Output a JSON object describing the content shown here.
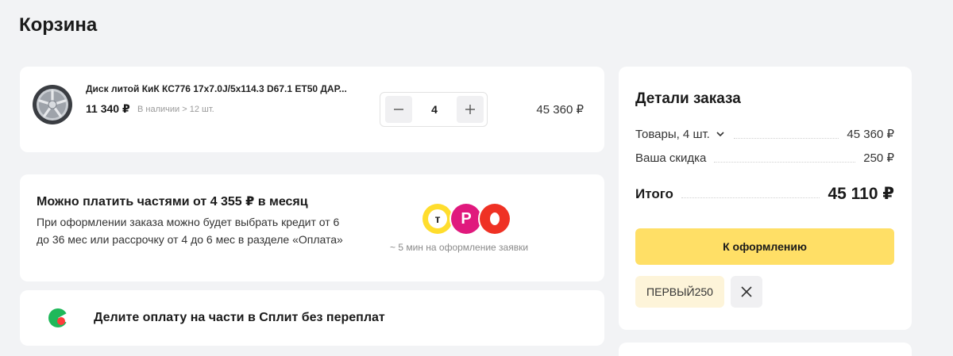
{
  "page": {
    "title": "Корзина"
  },
  "product": {
    "title": "Диск литой КиК КС776 17x7.0J/5x114.3 D67.1 ET50 ДАР...",
    "unit_price": "11 340 ₽",
    "stock": "В наличии > 12 шт.",
    "quantity": "4",
    "minus": "—",
    "plus": "+",
    "total": "45 360 ₽"
  },
  "installment": {
    "title": "Можно платить частями от 4 355 ₽ в месяц",
    "text": "При оформлении заказа можно будет выбрать кредит от 6 до 36 мес или рассрочку от 4 до 6 мес в разделе «Оплата»",
    "bank_t_letter": "т",
    "bank_p_letter": "Р",
    "note": "~ 5 мин на оформление заявки"
  },
  "split": {
    "text": "Делите оплату на части в Сплит без переплат"
  },
  "order": {
    "title": "Детали заказа",
    "goods_label": "Товары, 4 шт.",
    "goods_value": "45 360 ₽",
    "discount_label": "Ваша скидка",
    "discount_value": "250 ₽",
    "total_label": "Итого",
    "total_value": "45 110 ₽",
    "checkout_label": "К оформлению",
    "promo_code": "ПЕРВЫЙ250"
  },
  "colors": {
    "checkout": "#ffdf66",
    "promo_bg": "#fdf4d9",
    "tbank": "#ffdd2d",
    "bank_p": "#e0197d",
    "bank_a": "#ef3124",
    "split": "#1fb85a"
  },
  "icons": {
    "wheel": "wheel-image",
    "chevron": "chevron-down-icon",
    "close": "close-icon",
    "split": "split-logo-icon"
  }
}
